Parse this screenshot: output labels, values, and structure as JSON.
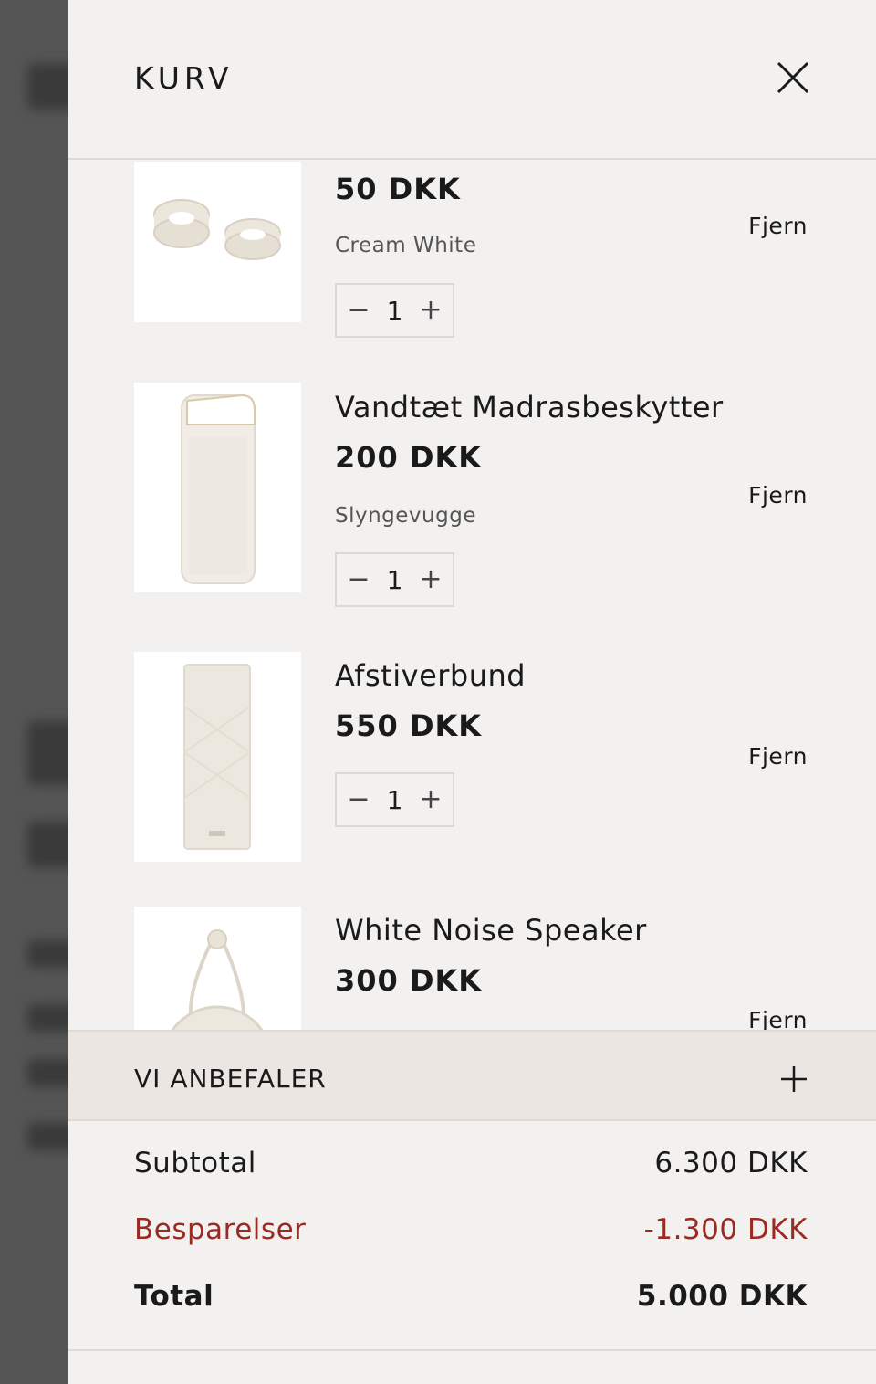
{
  "header": {
    "title": "KURV",
    "close_icon": "close-icon"
  },
  "items": [
    {
      "name": "",
      "price": "50 DKK",
      "variant": "Cream White",
      "quantity": "1",
      "remove_label": "Fjern",
      "image": "cream-clips-product-image"
    },
    {
      "name": "Vandtæt Madrasbeskytter",
      "price": "200 DKK",
      "variant": "Slyngevugge",
      "quantity": "1",
      "remove_label": "Fjern",
      "image": "mattress-protector-product-image"
    },
    {
      "name": "Afstiverbund",
      "price": "550 DKK",
      "variant": "",
      "quantity": "1",
      "remove_label": "Fjern",
      "image": "quilted-mattress-product-image"
    },
    {
      "name": "White Noise Speaker",
      "price": "300 DKK",
      "variant": "",
      "quantity": "",
      "remove_label": "Fjern",
      "image": "white-noise-speaker-product-image"
    }
  ],
  "stepper": {
    "minus_symbol": "−",
    "plus_symbol": "+"
  },
  "recommend": {
    "label": "VI ANBEFALER",
    "icon": "plus-icon"
  },
  "summary": {
    "subtotal_label": "Subtotal",
    "subtotal_value": "6.300 DKK",
    "savings_label": "Besparelser",
    "savings_value": "-1.300 DKK",
    "total_label": "Total",
    "total_value": "5.000 DKK"
  },
  "colors": {
    "drawer_bg": "#f3f1ef",
    "recommend_bg": "#ebe6e2",
    "savings_red": "#9b2a22",
    "text": "#1a1a1a"
  }
}
